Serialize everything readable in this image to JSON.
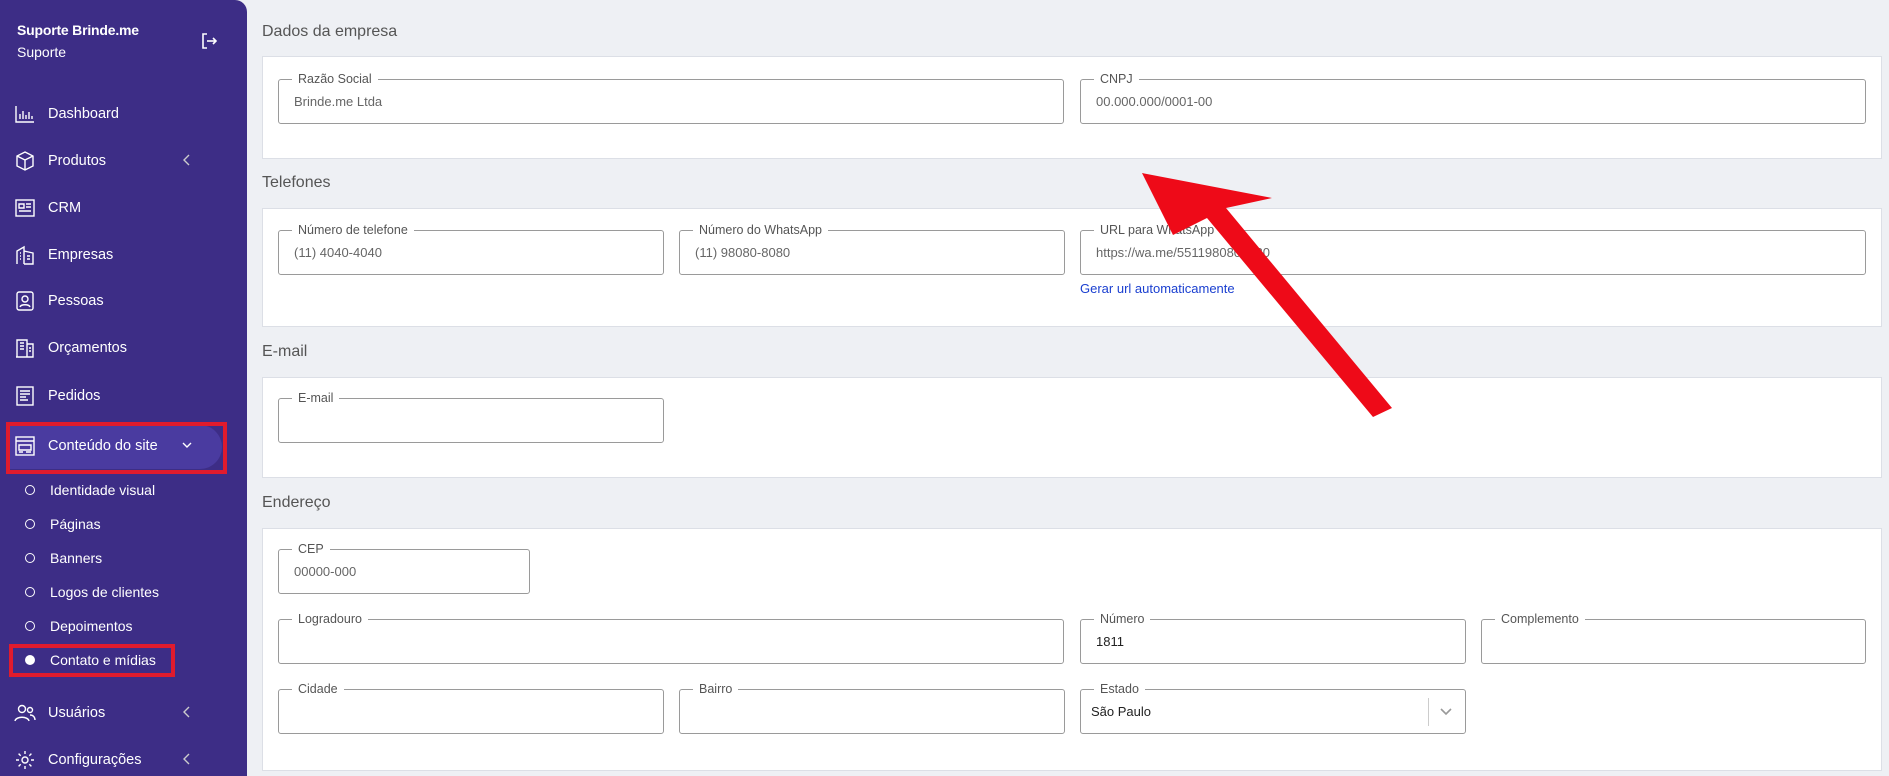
{
  "sidebar": {
    "company": "Suporte Brinde.me",
    "role": "Suporte",
    "items": [
      {
        "label": "Dashboard",
        "icon": "bar-chart-icon"
      },
      {
        "label": "Produtos",
        "icon": "box-icon"
      },
      {
        "label": "CRM",
        "icon": "crm-icon"
      },
      {
        "label": "Empresas",
        "icon": "building-icon"
      },
      {
        "label": "Pessoas",
        "icon": "person-icon"
      },
      {
        "label": "Orçamentos",
        "icon": "budget-icon"
      },
      {
        "label": "Pedidos",
        "icon": "orders-icon"
      },
      {
        "label": "Conteúdo do site",
        "icon": "site-content-icon"
      },
      {
        "label": "Usuários",
        "icon": "users-icon"
      },
      {
        "label": "Configurações",
        "icon": "gear-icon"
      }
    ],
    "subitems": [
      {
        "label": "Identidade visual"
      },
      {
        "label": "Páginas"
      },
      {
        "label": "Banners"
      },
      {
        "label": "Logos de clientes"
      },
      {
        "label": "Depoimentos"
      },
      {
        "label": "Contato e mídias"
      }
    ]
  },
  "sections": {
    "empresa": {
      "title": "Dados da empresa",
      "razao_label": "Razão Social",
      "razao_value": "Brinde.me Ltda",
      "cnpj_label": "CNPJ",
      "cnpj_value": "00.000.000/0001-00"
    },
    "telefones": {
      "title": "Telefones",
      "phone_label": "Número de telefone",
      "phone_value": "(11) 4040-4040",
      "whatsapp_label": "Número do WhatsApp",
      "whatsapp_value": "(11) 98080-8080",
      "url_label": "URL para WhatsApp",
      "url_value": "https://wa.me/5511980808080",
      "gen_link": "Gerar url automaticamente"
    },
    "email": {
      "title": "E-mail",
      "email_label": "E-mail",
      "email_value": ""
    },
    "endereco": {
      "title": "Endereço",
      "cep_label": "CEP",
      "cep_value": "00000-000",
      "logradouro_label": "Logradouro",
      "logradouro_value": "",
      "numero_label": "Número",
      "numero_value": "1811",
      "complemento_label": "Complemento",
      "complemento_value": "",
      "cidade_label": "Cidade",
      "cidade_value": "",
      "bairro_label": "Bairro",
      "bairro_value": "",
      "estado_label": "Estado",
      "estado_value": "São Paulo"
    }
  },
  "colors": {
    "sidebar_bg": "#3d2d86",
    "highlight": "#e01b2d",
    "link": "#1a3fd0"
  }
}
